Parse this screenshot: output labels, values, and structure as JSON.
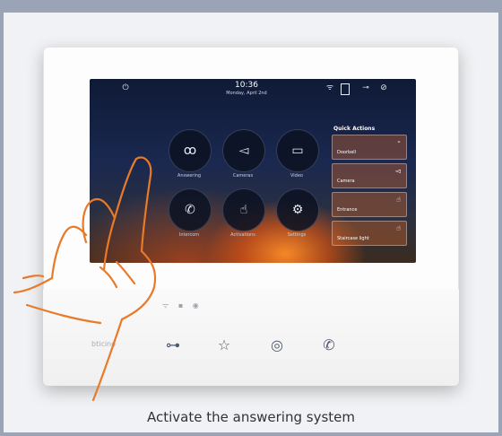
{
  "caption": "Activate the answering system",
  "device": {
    "brand": "bticino",
    "status_bar": {
      "time": "10:36",
      "date": "Monday, April 2nd"
    },
    "apps": [
      {
        "label": "Answering",
        "icon": "voicemail-icon"
      },
      {
        "label": "Cameras",
        "icon": "camera-icon"
      },
      {
        "label": "Video",
        "icon": "screen-icon"
      },
      {
        "label": "Intercom",
        "icon": "phone-icon"
      },
      {
        "label": "Activations",
        "icon": "hand-icon"
      },
      {
        "label": "Settings",
        "icon": "gear-icon"
      }
    ],
    "quick_actions": {
      "title": "Quick Actions",
      "items": [
        {
          "label": "Doorbell",
          "icon": "bell-icon"
        },
        {
          "label": "Camera",
          "icon": "camera-icon"
        },
        {
          "label": "Entrance",
          "icon": "hand-icon"
        },
        {
          "label": "Staircase light",
          "icon": "hand-icon"
        }
      ]
    },
    "buttons": [
      "key-icon",
      "star-icon",
      "eye-icon",
      "phone-icon"
    ]
  },
  "colors": {
    "frame": "#9aa4b6",
    "accent": "#e87a2a",
    "hand_stroke": "#e87a2a"
  }
}
